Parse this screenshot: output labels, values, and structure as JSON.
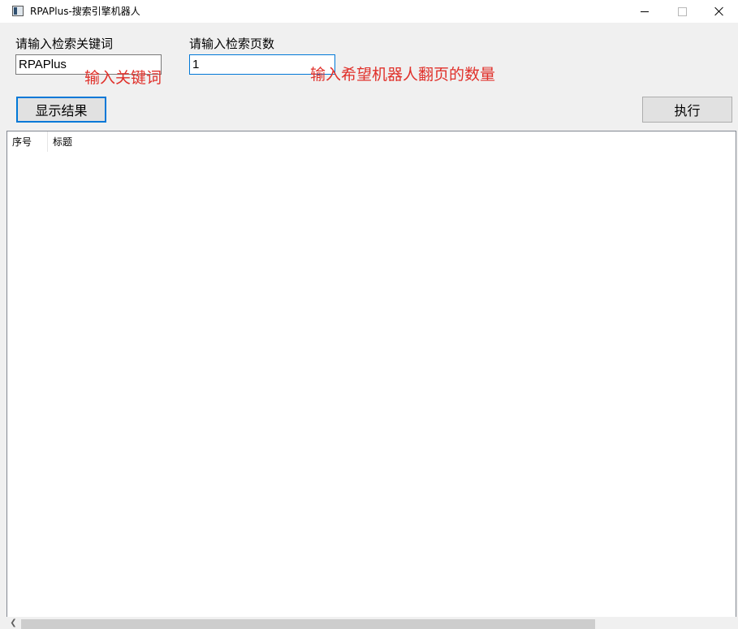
{
  "window": {
    "title": "RPAPlus-搜索引擎机器人",
    "icon": "app-window-icon"
  },
  "form": {
    "keyword_label": "请输入检索关键词",
    "keyword_value": "RPAPlus",
    "keyword_hint": "输入关键词",
    "pages_label": "请输入检索页数",
    "pages_value": "1",
    "pages_hint": "输入希望机器人翻页的数量"
  },
  "buttons": {
    "show_results": "显示结果",
    "execute": "执行"
  },
  "results_table": {
    "columns": [
      "序号",
      "标题"
    ],
    "rows": []
  },
  "colors": {
    "hint": "#e0302a",
    "focus_border": "#0078d7",
    "window_bg": "#f0f0f0"
  }
}
